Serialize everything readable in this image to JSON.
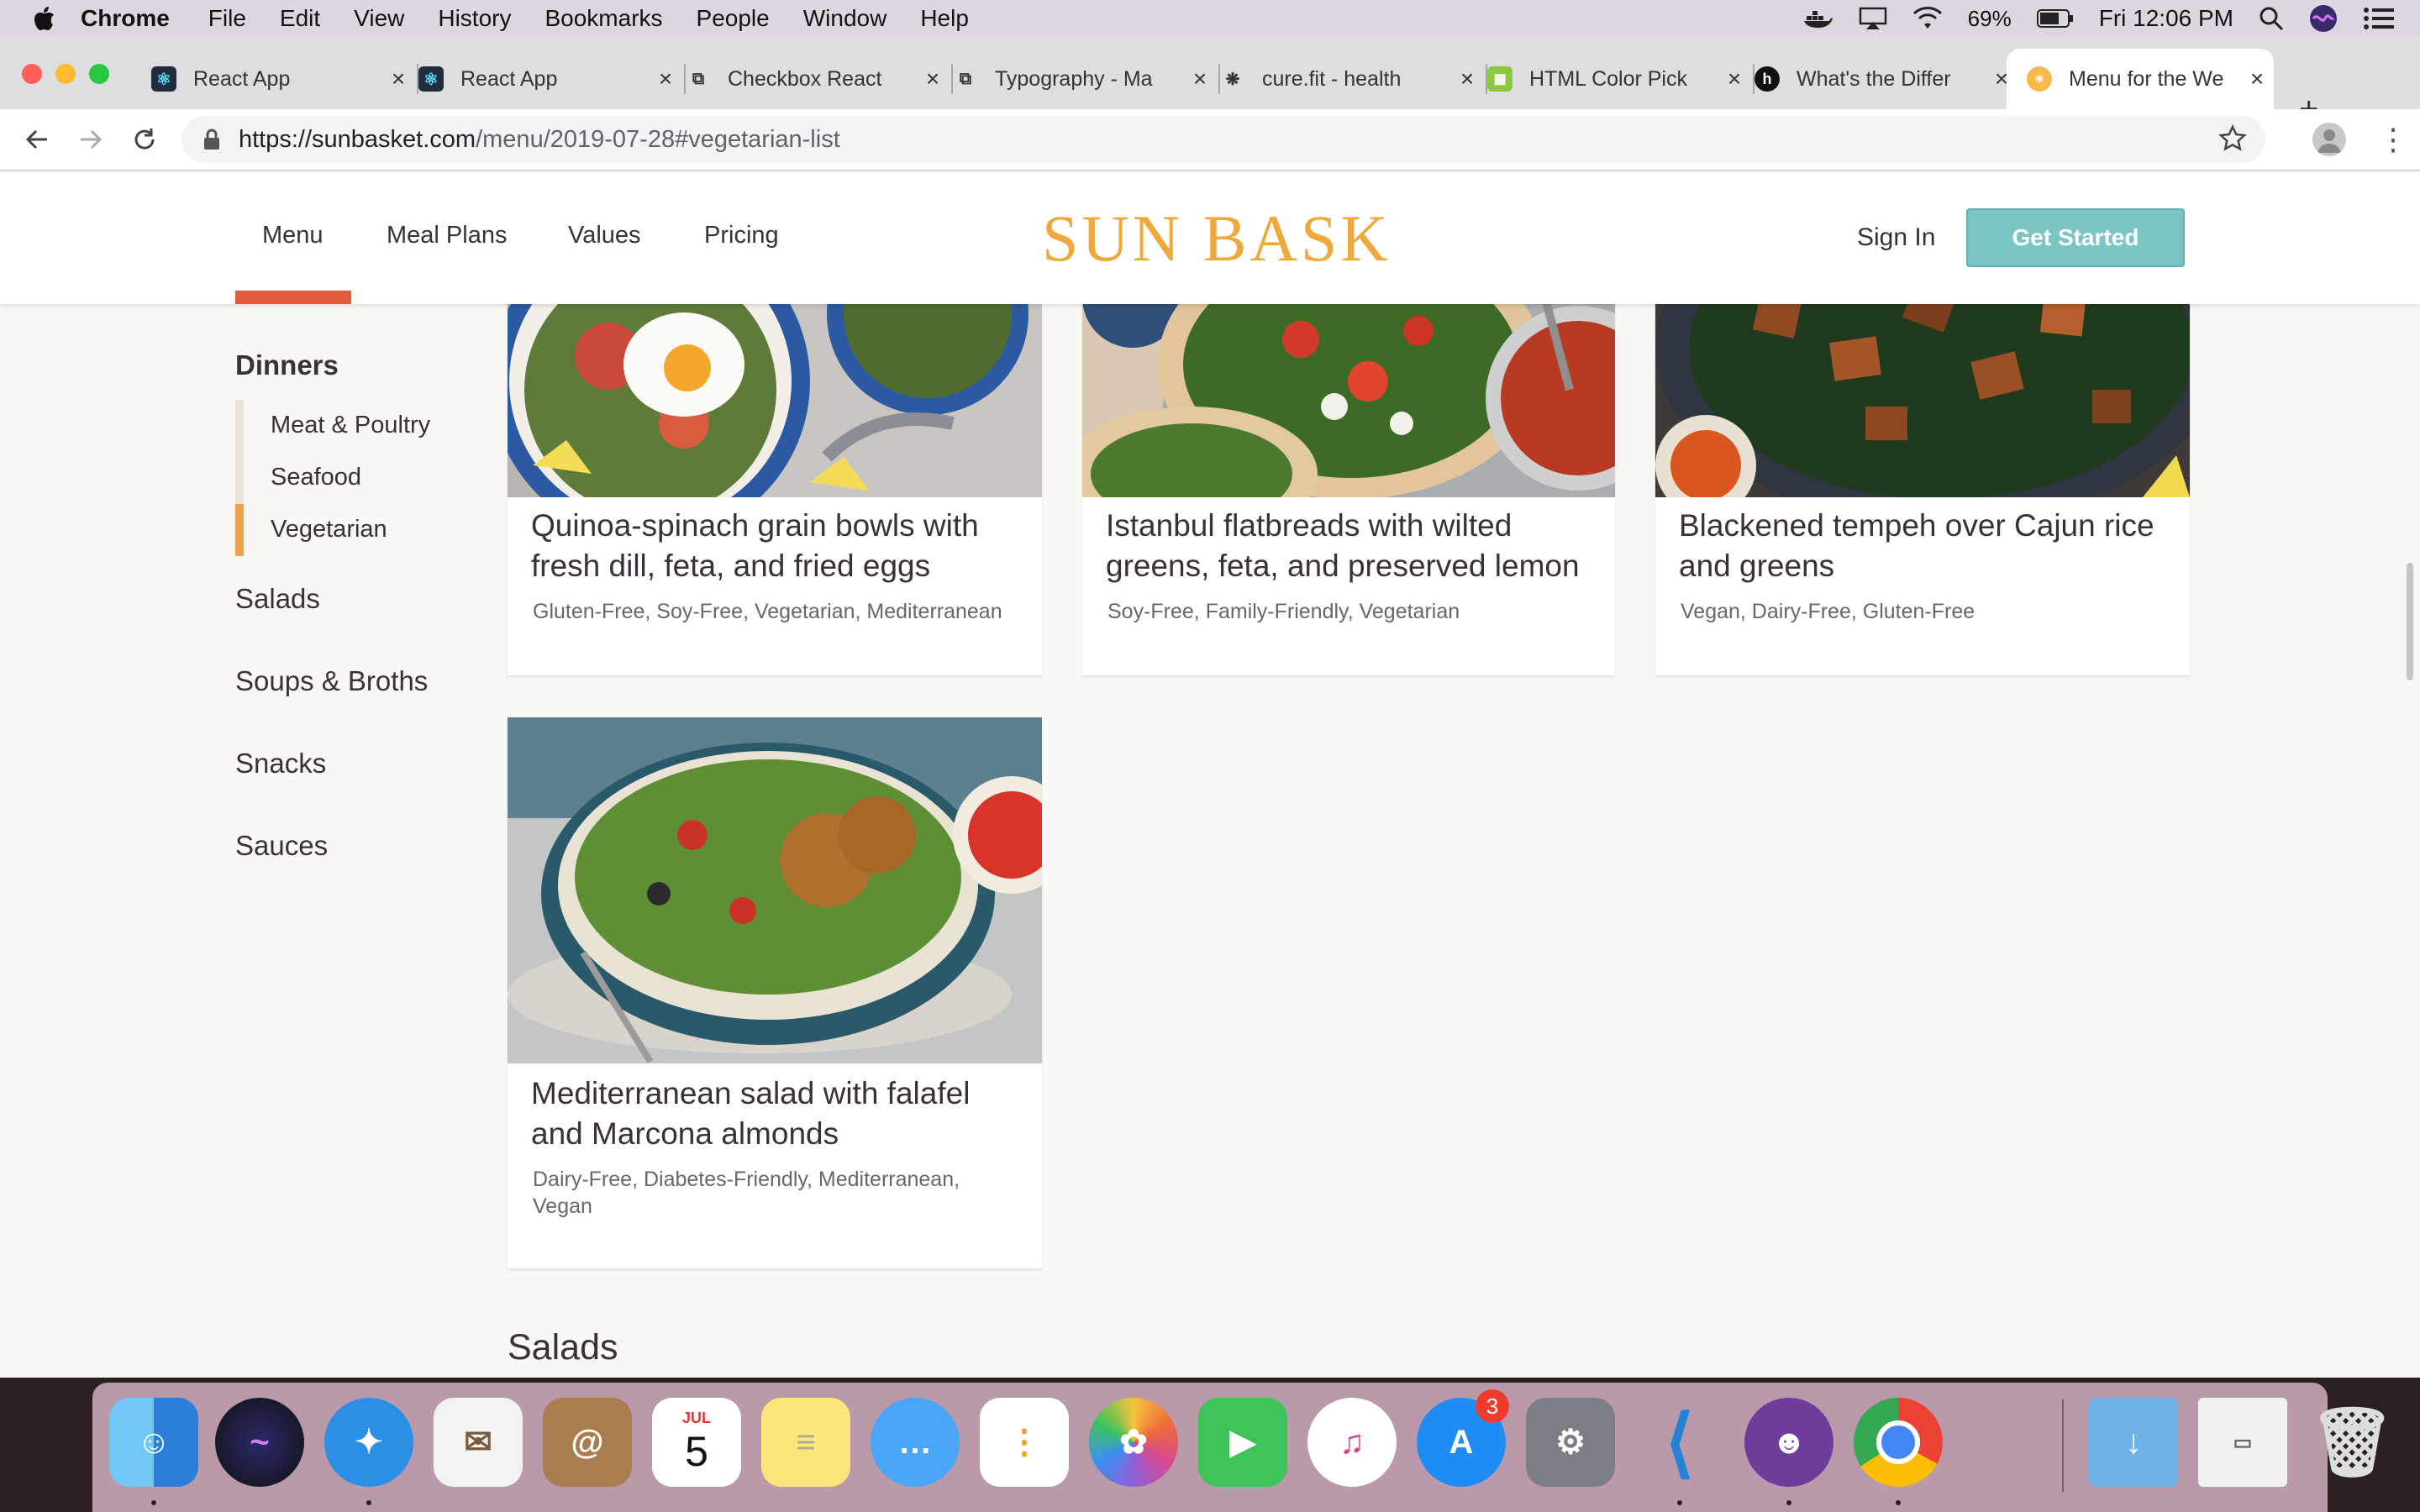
{
  "menubar": {
    "app": "Chrome",
    "items": [
      "File",
      "Edit",
      "View",
      "History",
      "Bookmarks",
      "People",
      "Window",
      "Help"
    ],
    "battery": "69%",
    "clock": "Fri 12:06 PM"
  },
  "tabs": [
    {
      "title": "React App",
      "favicon": "react-icon"
    },
    {
      "title": "React App",
      "favicon": "react-icon"
    },
    {
      "title": "Checkbox React",
      "favicon": "material-ui-icon"
    },
    {
      "title": "Typography - Ma",
      "favicon": "material-ui-icon"
    },
    {
      "title": "cure.fit - health",
      "favicon": "curefit-icon"
    },
    {
      "title": "HTML Color Pick",
      "favicon": "color-picker-icon"
    },
    {
      "title": "What's the Differ",
      "favicon": "hashnode-icon"
    },
    {
      "title": "Menu for the We",
      "favicon": "sunbasket-icon",
      "active": true
    }
  ],
  "url": {
    "host": "https://sunbasket.com",
    "path": "/menu/2019-07-28#vegetarian-list"
  },
  "site": {
    "nav": [
      "Menu",
      "Meal Plans",
      "Values",
      "Pricing"
    ],
    "active_nav": "Menu",
    "logo": "SUN BASKET",
    "sign_in": "Sign In",
    "get_started": "Get Started",
    "accent_color": "#e05d3c",
    "button_color": "#7ac6c4"
  },
  "sidebar": {
    "heading": "Dinners",
    "subitems": [
      "Meat & Poultry",
      "Seafood",
      "Vegetarian"
    ],
    "active_subitem": "Vegetarian",
    "categories": [
      "Salads",
      "Soups & Broths",
      "Snacks",
      "Sauces"
    ]
  },
  "cards": [
    {
      "title_line1": "Quinoa-spinach grain bowls with",
      "title_line2": "fresh dill, feta, and fried eggs",
      "tags_line1": "Gluten-Free, Soy-Free, Vegetarian, Mediterranean",
      "tags_line2": ""
    },
    {
      "title_line1": "Istanbul flatbreads with wilted",
      "title_line2": "greens, feta, and preserved lemon",
      "tags_line1": "Soy-Free, Family-Friendly, Vegetarian",
      "tags_line2": ""
    },
    {
      "title_line1": "Blackened tempeh over Cajun rice",
      "title_line2": "and greens",
      "tags_line1": "Vegan, Dairy-Free, Gluten-Free",
      "tags_line2": ""
    },
    {
      "title_line1": "Mediterranean salad with falafel",
      "title_line2": "and Marcona almonds",
      "tags_line1": "Dairy-Free, Diabetes-Friendly, Mediterranean,",
      "tags_line2": "Vegan"
    }
  ],
  "next_section": "Salads",
  "dock": {
    "calendar_month": "JUL",
    "calendar_day": "5",
    "appstore_badge": "3",
    "apps": [
      "finder-icon",
      "siri-icon",
      "safari-icon",
      "mail-icon",
      "contacts-icon",
      "calendar-icon",
      "notes-icon",
      "messages-icon",
      "reminders-icon",
      "photos-icon",
      "facetime-icon",
      "itunes-icon",
      "app-store-icon",
      "system-preferences-icon",
      "vscode-icon",
      "github-desktop-icon",
      "chrome-icon",
      "downloads-folder-icon",
      "screenshot-icon",
      "trash-icon"
    ]
  }
}
